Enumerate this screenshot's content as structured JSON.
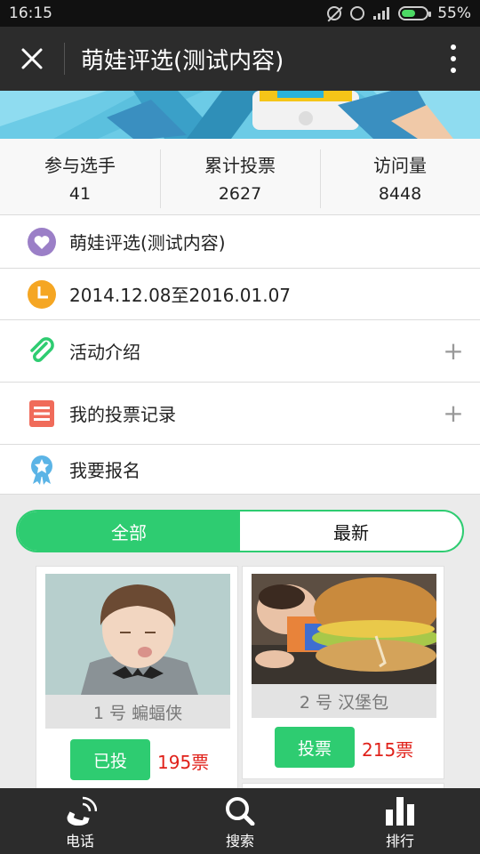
{
  "status_bar": {
    "time": "16:15",
    "battery": "55%",
    "battery_level": 0.55
  },
  "title_bar": {
    "title": "萌娃评选(测试内容)"
  },
  "stats": [
    {
      "label": "参与选手",
      "value": "41"
    },
    {
      "label": "累计投票",
      "value": "2627"
    },
    {
      "label": "访问量",
      "value": "8448"
    }
  ],
  "info": {
    "name": "萌娃评选(测试内容)",
    "date_range": "2014.12.08至2016.01.07",
    "intro": "活动介绍",
    "my_votes": "我的投票记录",
    "signup": "我要报名",
    "expand_symbol": "+"
  },
  "tabs": {
    "all": "全部",
    "latest": "最新"
  },
  "contestants": [
    {
      "name": "1 号 蝙蝠侠",
      "button": "已投",
      "votes": "195票"
    },
    {
      "name": "2 号 汉堡包",
      "button": "投票",
      "votes": "215票"
    }
  ],
  "bottom_nav": [
    {
      "label": "电话",
      "icon": "phone-icon"
    },
    {
      "label": "搜索",
      "icon": "search-icon"
    },
    {
      "label": "排行",
      "icon": "bar-chart-icon"
    }
  ],
  "colors": {
    "accent": "#2ecc71",
    "vote_count": "#e0211a",
    "titlebar": "#2c2c2c"
  }
}
